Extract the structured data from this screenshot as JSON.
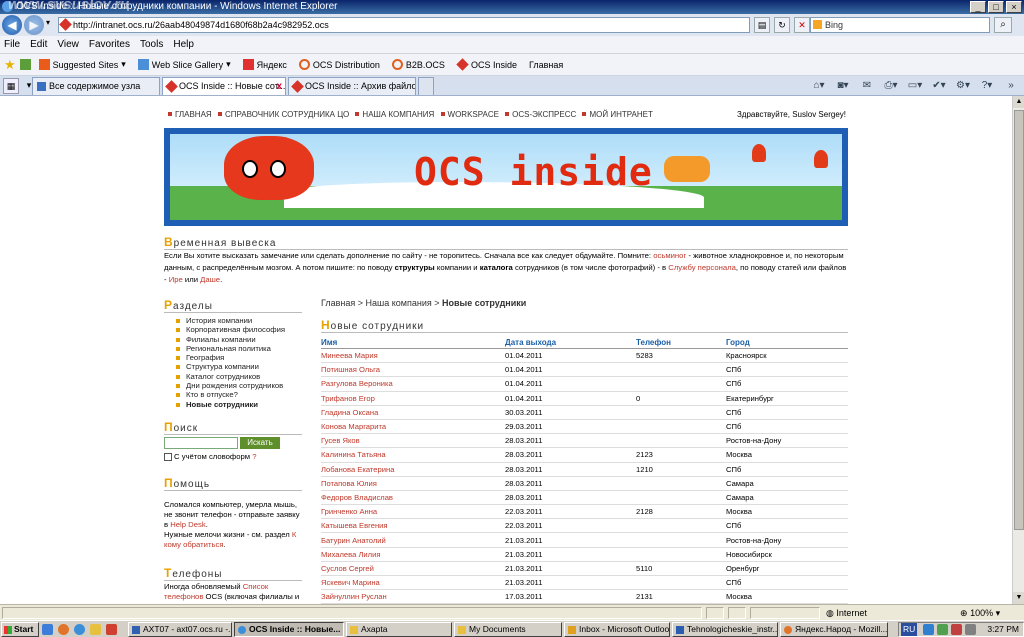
{
  "window": {
    "title": "OCS Inside :: Новые сотрудники компании - Windows Internet Explorer",
    "watermark": "www.svsuslov.ru"
  },
  "addressbar": {
    "url": "http://intranet.ocs.ru/26aab48049874d1680f68b2a4c982952.ocs",
    "search_placeholder": "Bing"
  },
  "menu": [
    "File",
    "Edit",
    "View",
    "Favorites",
    "Tools",
    "Help"
  ],
  "favorites": [
    "Suggested Sites",
    "Web Slice Gallery",
    "Яндекс",
    "OCS Distribution",
    "B2B.OCS",
    "OCS Inside",
    "Главная"
  ],
  "tabs": [
    {
      "label": "Все содержимое узла"
    },
    {
      "label": "OCS Inside :: Новые сот..."
    },
    {
      "label": "OCS Inside :: Архив файло..."
    }
  ],
  "page": {
    "topnav": [
      "ГЛАВНАЯ",
      "СПРАВОЧНИК СОТРУДНИКА ЦО",
      "НАША КОМПАНИЯ",
      "WORKSPACE",
      "OCS-ЭКСПРЕСС",
      "МОЙ ИНТРАНЕТ"
    ],
    "greeting": "Здравствуйте, Suslov Sergey!",
    "banner_title": "OCS inside",
    "notice": {
      "heading_first": "В",
      "heading_rest": "ременная вывеска",
      "p1": "Если Вы хотите высказать замечание или сделать дополнение по сайту - не торопитесь. Сначала все как следует обдумайте. Помните: ",
      "l1": "осьминог",
      "p2": " - животное хладнокровное и, по некоторым данным, с распределённым мозгом. А потом пишите: по поводу ",
      "b1": "структуры",
      "p3": " компании и ",
      "b2": "каталога",
      "p4": " сотрудников (в том числе фотографий) - в ",
      "l2": "Службу персонала",
      "p5": ", по поводу статей или файлов - ",
      "l3": "Ире",
      "p6": " или ",
      "l4": "Даше",
      "p7": "."
    },
    "sections": {
      "heading_first": "Р",
      "heading_rest": "азделы",
      "items": [
        "История компании",
        "Корпоративная философия",
        "Филиалы компании",
        "Региональная политика",
        "География",
        "Структура компании",
        "Каталог сотрудников",
        "Дни рождения сотрудников",
        "Кто в отпуске?",
        "Новые сотрудники"
      ]
    },
    "search": {
      "heading_first": "П",
      "heading_rest": "оиск",
      "button": "Искать",
      "checkbox_label": "С учётом словоформ",
      "help_mark": "?"
    },
    "help": {
      "heading_first": "П",
      "heading_rest": "омощь",
      "t1": "Сломался компьютер, умерла мышь, не звонит телефон - отправьте заявку в ",
      "l1": "Help Desk",
      "t2": ".",
      "t3": "Нужные мелочи жизни - см. раздел ",
      "l2": "К кому обратиться",
      "t4": "."
    },
    "phones": {
      "heading_first": "Т",
      "heading_rest": "елефоны",
      "t1": "Иногда обновляемый ",
      "l1": "Список телефонов",
      "t2": " OCS (включая филиалы и"
    },
    "breadcrumb": {
      "home": "Главная",
      "sep": " > ",
      "company": "Наша компания",
      "current": "Новые сотрудники"
    },
    "employees": {
      "heading_first": "Н",
      "heading_rest": "овые сотрудники",
      "columns": [
        "Имя",
        "Дата выхода",
        "Телефон",
        "Город"
      ],
      "rows": [
        [
          "Минеева Мария",
          "01.04.2011",
          "5283",
          "Красноярск"
        ],
        [
          "Потишная Ольга",
          "01.04.2011",
          "",
          "СПб"
        ],
        [
          "Разгулова Вероника",
          "01.04.2011",
          "",
          "СПб"
        ],
        [
          "Трифанов Егор",
          "01.04.2011",
          "0",
          "Екатеринбург"
        ],
        [
          "Гладина Оксана",
          "30.03.2011",
          "",
          "СПб"
        ],
        [
          "Конова Маргарита",
          "29.03.2011",
          "",
          "СПб"
        ],
        [
          "Гусев Яков",
          "28.03.2011",
          "",
          "Ростов-на-Дону"
        ],
        [
          "Калинина Татьяна",
          "28.03.2011",
          "2123",
          "Москва"
        ],
        [
          "Лобанова Екатерина",
          "28.03.2011",
          "1210",
          "СПб"
        ],
        [
          "Потапова Юлия",
          "28.03.2011",
          "",
          "Самара"
        ],
        [
          "Федоров Владислав",
          "28.03.2011",
          "",
          "Самара"
        ],
        [
          "Гринченко Анна",
          "22.03.2011",
          "2128",
          "Москва"
        ],
        [
          "Катышева Евгения",
          "22.03.2011",
          "",
          "СПб"
        ],
        [
          "Батурин Анатолий",
          "21.03.2011",
          "",
          "Ростов-на-Дону"
        ],
        [
          "Михалева Лилия",
          "21.03.2011",
          "",
          "Новосибирск"
        ],
        [
          "Суслов Сергей",
          "21.03.2011",
          "5110",
          "Оренбург"
        ],
        [
          "Яскевич Марина",
          "21.03.2011",
          "",
          "СПб"
        ],
        [
          "Зайнуллин Руслан",
          "17.03.2011",
          "2131",
          "Москва"
        ]
      ]
    }
  },
  "statusbar": {
    "zone": "Internet",
    "zoom": "100%"
  },
  "taskbar": {
    "start": "Start",
    "tasks": [
      "AXT07 - axt07.ocs.ru -...",
      "OCS Inside :: Новые...",
      "Axapta",
      "My Documents",
      "Inbox - Microsoft Outlook",
      "Tehnologicheskie_instr...",
      "Яндекс.Народ - Mozill..."
    ],
    "lang": "RU",
    "clock": "3:27 PM"
  },
  "colors": {
    "link_red": "#c0392b",
    "heading_orange": "#e6a100",
    "table_header_blue": "#1a5fa8",
    "search_green": "#5f8f2a"
  }
}
